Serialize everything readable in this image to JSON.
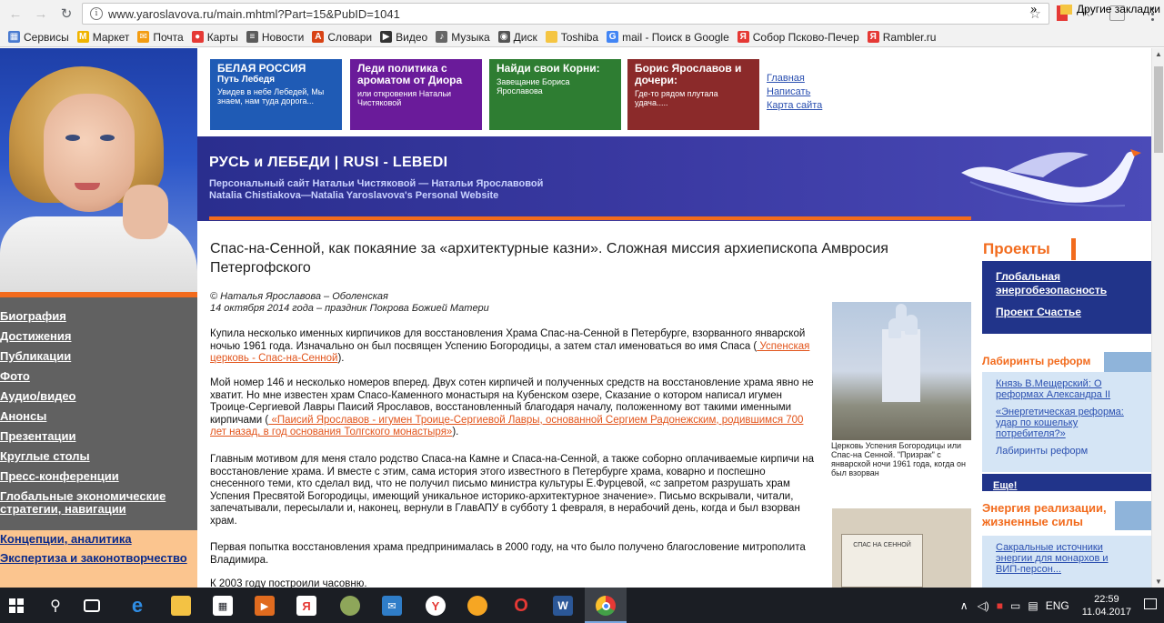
{
  "browser": {
    "url": "www.yaroslavova.ru/main.mhtml?Part=15&PubID=1041",
    "bookmarks": [
      {
        "label": "Сервисы",
        "color": "#4a7bd0",
        "glyph": "▦"
      },
      {
        "label": "Маркет",
        "color": "#f0b400",
        "glyph": "М"
      },
      {
        "label": "Почта",
        "color": "#f39c12",
        "glyph": "✉"
      },
      {
        "label": "Карты",
        "color": "#e53935",
        "glyph": "●"
      },
      {
        "label": "Новости",
        "color": "#5b5b5b",
        "glyph": "≡"
      },
      {
        "label": "Словари",
        "color": "#d84315",
        "glyph": "A"
      },
      {
        "label": "Видео",
        "color": "#333333",
        "glyph": "▶"
      },
      {
        "label": "Музыка",
        "color": "#666666",
        "glyph": "♪"
      },
      {
        "label": "Диск",
        "color": "#555555",
        "glyph": "◉"
      },
      {
        "label": "Toshiba",
        "color": "#f5c542",
        "glyph": ""
      },
      {
        "label": "mail - Поиск в Google",
        "color": "#4285f4",
        "glyph": "G"
      },
      {
        "label": "Собор Псково-Печер",
        "color": "#e53935",
        "glyph": "Я"
      },
      {
        "label": "Rambler.ru",
        "color": "#e53935",
        "glyph": "Я"
      }
    ],
    "more_label": "»",
    "other_bookmarks": "Другие закладки"
  },
  "promos": [
    {
      "title": "БЕЛАЯ РОССИЯ",
      "title2": "Путь Лебедя",
      "sub": "Увидев в небе Лебедей, Мы знаем, нам туда дорога...",
      "color": "#1f5bb5"
    },
    {
      "title": "Леди политика с ароматом от Диора",
      "title2": "",
      "sub": "или откровения Натальи Чистяковой",
      "color": "#6a1b9a"
    },
    {
      "title": "Найди свои Корни:",
      "title2": "",
      "sub": "Завещание Бориса Ярославова",
      "color": "#2e7d32"
    },
    {
      "title": "Борис Ярославов и дочери:",
      "title2": "",
      "sub": "Где-то рядом плутала удача.....",
      "color": "#8b2a2a"
    }
  ],
  "top_links": [
    "Главная",
    "Написать",
    "Карта сайта"
  ],
  "banner": {
    "title": "РУСЬ и ЛЕБЕДИ | RUSI - LEBEDI",
    "sub1": "Персональный сайт Натальи Чистяковой — Натальи Ярославовой",
    "sub2": "Natalia Chistiakova—Natalia Yaroslavova's  Personal Website"
  },
  "left_menu": [
    "Биография",
    "Достижения",
    "Публикации",
    "Фото",
    "Аудио/видео",
    "Анонсы",
    "Презентации",
    "Круглые столы",
    "Пресс-конференции",
    "Глобальные экономические стратегии, навигации"
  ],
  "left_menu_lower": [
    "Концепции, аналитика",
    "Экспертиза и законотворчество"
  ],
  "article": {
    "title": "Спас-на-Сенной, как покаяние за «архитектурные казни». Сложная миссия архиепископа Амвросия Петергофского",
    "author": "© Наталья Ярославова – Оболенская",
    "date": "14 октября 2014 года – праздник Покрова Божией Матери",
    "p1a": "Купила несколько именных кирпичиков для восстановления Храма Спас-на-Сенной в Петербурге, взорванного январской ночью 1961 года. Изначально он был посвящен Успению Богородицы, а затем стал именоваться во имя Спаса (",
    "p1_link": " Успенская церковь - Спас-на-Сенной",
    "p1b": ").",
    "p2a": "Мой номер 146 и несколько номеров вперед. Двух сотен кирпичей и полученных средств на восстановление храма явно не хватит. Но мне известен храм Спасо-Каменного монастыря на Кубенском озере, Сказание о котором написал игумен Троице-Сергиевой Лавры Паисий Ярославов, восстановленный благодаря началу, положенному вот такими именными кирпичами (",
    "p2_link": " «Паисий Ярославов - игумен Троице-Сергиевой Лавры, основанной Сергием Радонежским, родившимся 700 лет назад, в год основания Толгского монастыря»",
    "p2b": ").",
    "p3": "Главным мотивом для меня стало родство Спаса-на Камне и Спаса-на-Сенной, а также соборно оплачиваемые кирпичи на восстановление храма. И вместе с этим, сама история этого известного в Петербурге храма, коварно и поспешно снесенного теми, кто сделал вид, что не получил письмо министра культуры Е.Фурцевой, «с запретом разрушать храм Успения Пресвятой Богородицы, имеющий уникальное историко-архитектурное значение». Письмо вскрывали, читали, запечатывали, пересылали и, наконец, вернули в ГлавАПУ в субботу 1 февраля, в нерабочий день, когда и был взорван храм.",
    "p4": "Первая попытка восстановления храма предпринималась в 2000 году, на что было получено благословение митрополита Владимира.",
    "p5": "К 2003 году построили часовню.",
    "photo_caption": "Церковь Успения Богородицы или Спас-на Сенной. \"Призрак\" с январской ночи 1961 года, когда он был взорван",
    "card_text": "СПАС НА СЕННОЙ"
  },
  "right_sidebar": {
    "projects_title": "Проекты",
    "projects": [
      "Глобальная энергобезопасность",
      "Проект Счастье"
    ],
    "reforms_title": "Лабиринты реформ",
    "reforms": [
      "Князь В.Мещерский: О реформах Александра II",
      "«Энергетическая реформа: удар по кошельку потребителя?»",
      "Лабиринты реформ"
    ],
    "more": "Еще!",
    "energy_title": "Энергия реализации, жизненные силы",
    "energy": [
      "Сакральные источники энергии для монархов и ВИП-персон..."
    ]
  },
  "taskbar": {
    "lang": "ENG",
    "time": "22:59",
    "date": "11.04.2017"
  },
  "colors": {
    "accent_orange": "#f26b1d",
    "sidebar_gray": "#616161",
    "banner_blue": "#2a2e8e",
    "link_blue": "#2a4fb0"
  }
}
